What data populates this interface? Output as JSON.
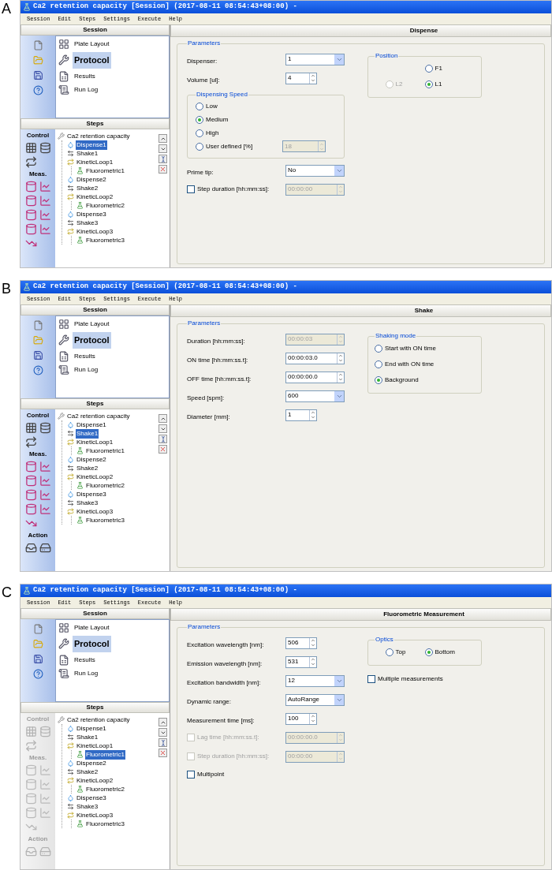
{
  "panels": [
    {
      "letter": "A",
      "window_title": "Ca2 retention capacity [Session] (2017-08-11 08:54:43+08:00) -",
      "menu": [
        "Session",
        "Edit",
        "Steps",
        "Settings",
        "Execute",
        "Help"
      ],
      "session": {
        "header": "Session",
        "items": [
          {
            "label": "Plate Layout",
            "kind": "plate",
            "selected": false
          },
          {
            "label": "Protocol",
            "kind": "protocol",
            "selected": true
          },
          {
            "label": "Results",
            "kind": "results",
            "selected": false
          },
          {
            "label": "Run Log",
            "kind": "log",
            "selected": false
          }
        ]
      },
      "steps": {
        "header": "Steps",
        "toolbox": {
          "disabled": false,
          "sections": [
            "Control",
            "Meas."
          ]
        },
        "tree": {
          "label": "Ca2 retention capacity",
          "kind": "root",
          "selected": false,
          "children": [
            {
              "label": "Dispense1",
              "kind": "dispense",
              "selected": true
            },
            {
              "label": "Shake1",
              "kind": "shake",
              "selected": false
            },
            {
              "label": "KineticLoop1",
              "kind": "loop",
              "selected": false,
              "children": [
                {
                  "label": "Fluorometric1",
                  "kind": "fluoro",
                  "selected": false
                }
              ]
            },
            {
              "label": "Dispense2",
              "kind": "dispense",
              "selected": false
            },
            {
              "label": "Shake2",
              "kind": "shake",
              "selected": false
            },
            {
              "label": "KineticLoop2",
              "kind": "loop",
              "selected": false,
              "children": [
                {
                  "label": "Fluorometric2",
                  "kind": "fluoro",
                  "selected": false
                }
              ]
            },
            {
              "label": "Dispense3",
              "kind": "dispense",
              "selected": false
            },
            {
              "label": "Shake3",
              "kind": "shake",
              "selected": false
            },
            {
              "label": "KineticLoop3",
              "kind": "loop",
              "selected": false,
              "children": [
                {
                  "label": "Fluorometric3",
                  "kind": "fluoro",
                  "selected": false
                }
              ]
            }
          ]
        }
      },
      "editor": {
        "title": "Dispense",
        "group": "Parameters",
        "fields": [
          {
            "kind": "select",
            "label": "Dispenser:",
            "value": "1",
            "disabled": false
          },
          {
            "kind": "spin",
            "label": "Volume [ul]:",
            "value": "4",
            "disabled": false
          },
          {
            "kind": "radio-group",
            "label": "Dispensing Speed",
            "options": [
              {
                "label": "Low",
                "selected": false
              },
              {
                "label": "Medium",
                "selected": true
              },
              {
                "label": "High",
                "selected": false
              },
              {
                "label": "User defined [%]",
                "selected": false,
                "value": "18",
                "value_disabled": true
              }
            ]
          },
          {
            "kind": "select",
            "label": "Prime tip:",
            "value": "No",
            "disabled": false
          },
          {
            "kind": "checkbox-spin",
            "label": "Step duration [hh:mm:ss]:",
            "checked": false,
            "disabled": false,
            "value": "00:00:00",
            "value_disabled": true
          }
        ],
        "side": [
          {
            "kind": "radio-group",
            "label": "Position",
            "rows": [
              [
                "",
                {
                  "label": "F1",
                  "selected": false,
                  "disabled": false
                }
              ],
              [
                {
                  "label": "L2",
                  "selected": false,
                  "disabled": true
                },
                {
                  "label": "L1",
                  "selected": true,
                  "disabled": false
                }
              ]
            ]
          }
        ]
      }
    },
    {
      "letter": "B",
      "window_title": "Ca2 retention capacity [Session] (2017-08-11 08:54:43+08:00) -",
      "menu": [
        "Session",
        "Edit",
        "Steps",
        "Settings",
        "Execute",
        "Help"
      ],
      "session": {
        "header": "Session",
        "items": [
          {
            "label": "Plate Layout",
            "kind": "plate",
            "selected": false
          },
          {
            "label": "Protocol",
            "kind": "protocol",
            "selected": true
          },
          {
            "label": "Results",
            "kind": "results",
            "selected": false
          },
          {
            "label": "Run Log",
            "kind": "log",
            "selected": false
          }
        ]
      },
      "steps": {
        "header": "Steps",
        "toolbox": {
          "disabled": false,
          "sections": [
            "Control",
            "Meas.",
            "Action"
          ]
        },
        "tree": {
          "label": "Ca2 retention capacity",
          "kind": "root",
          "selected": false,
          "children": [
            {
              "label": "Dispense1",
              "kind": "dispense",
              "selected": false
            },
            {
              "label": "Shake1",
              "kind": "shake",
              "selected": true
            },
            {
              "label": "KineticLoop1",
              "kind": "loop",
              "selected": false,
              "children": [
                {
                  "label": "Fluorometric1",
                  "kind": "fluoro",
                  "selected": false
                }
              ]
            },
            {
              "label": "Dispense2",
              "kind": "dispense",
              "selected": false
            },
            {
              "label": "Shake2",
              "kind": "shake",
              "selected": false
            },
            {
              "label": "KineticLoop2",
              "kind": "loop",
              "selected": false,
              "children": [
                {
                  "label": "Fluorometric2",
                  "kind": "fluoro",
                  "selected": false
                }
              ]
            },
            {
              "label": "Dispense3",
              "kind": "dispense",
              "selected": false
            },
            {
              "label": "Shake3",
              "kind": "shake",
              "selected": false
            },
            {
              "label": "KineticLoop3",
              "kind": "loop",
              "selected": false,
              "children": [
                {
                  "label": "Fluorometric3",
                  "kind": "fluoro",
                  "selected": false
                }
              ]
            }
          ]
        }
      },
      "editor": {
        "title": "Shake",
        "group": "Parameters",
        "fields": [
          {
            "kind": "spin",
            "label": "Duration [hh:mm:ss]:",
            "value": "00:00:03",
            "disabled": true
          },
          {
            "kind": "spin",
            "label": "ON time [hh:mm:ss.t]:",
            "value": "00:00:03.0",
            "disabled": false
          },
          {
            "kind": "spin",
            "label": "OFF time [hh:mm:ss.t]:",
            "value": "00:00:00.0",
            "disabled": false
          },
          {
            "kind": "select",
            "label": "Speed [spm]:",
            "value": "600",
            "disabled": false
          },
          {
            "kind": "spin",
            "label": "Diameter [mm]:",
            "value": "1",
            "disabled": false
          }
        ],
        "side": [
          {
            "kind": "radio-group",
            "label": "Shaking mode",
            "rows": [
              [
                {
                  "label": "Start with ON time",
                  "selected": false,
                  "disabled": false
                }
              ],
              [
                {
                  "label": "End with ON time",
                  "selected": false,
                  "disabled": false
                }
              ],
              [
                {
                  "label": "Background",
                  "selected": true,
                  "disabled": false
                }
              ]
            ]
          }
        ]
      }
    },
    {
      "letter": "C",
      "window_title": "Ca2 retention capacity [Session] (2017-08-11 08:54:43+08:00) -",
      "menu": [
        "Session",
        "Edit",
        "Steps",
        "Settings",
        "Execute",
        "Help"
      ],
      "session": {
        "header": "Session",
        "items": [
          {
            "label": "Plate Layout",
            "kind": "plate",
            "selected": false
          },
          {
            "label": "Protocol",
            "kind": "protocol",
            "selected": true
          },
          {
            "label": "Results",
            "kind": "results",
            "selected": false
          },
          {
            "label": "Run Log",
            "kind": "log",
            "selected": false
          }
        ]
      },
      "steps": {
        "header": "Steps",
        "toolbox": {
          "disabled": true,
          "sections": [
            "Control",
            "Meas.",
            "Action"
          ]
        },
        "tree": {
          "label": "Ca2 retention capacity",
          "kind": "root",
          "selected": false,
          "children": [
            {
              "label": "Dispense1",
              "kind": "dispense",
              "selected": false
            },
            {
              "label": "Shake1",
              "kind": "shake",
              "selected": false
            },
            {
              "label": "KineticLoop1",
              "kind": "loop",
              "selected": false,
              "children": [
                {
                  "label": "Fluorometric1",
                  "kind": "fluoro",
                  "selected": true
                }
              ]
            },
            {
              "label": "Dispense2",
              "kind": "dispense",
              "selected": false
            },
            {
              "label": "Shake2",
              "kind": "shake",
              "selected": false
            },
            {
              "label": "KineticLoop2",
              "kind": "loop",
              "selected": false,
              "children": [
                {
                  "label": "Fluorometric2",
                  "kind": "fluoro",
                  "selected": false
                }
              ]
            },
            {
              "label": "Dispense3",
              "kind": "dispense",
              "selected": false
            },
            {
              "label": "Shake3",
              "kind": "shake",
              "selected": false
            },
            {
              "label": "KineticLoop3",
              "kind": "loop",
              "selected": false,
              "children": [
                {
                  "label": "Fluorometric3",
                  "kind": "fluoro",
                  "selected": false
                }
              ]
            }
          ]
        }
      },
      "editor": {
        "title": "Fluorometric Measurement",
        "group": "Parameters",
        "fields": [
          {
            "kind": "spin",
            "label": "Excitation wavelength [nm]:",
            "value": "506",
            "disabled": false
          },
          {
            "kind": "spin",
            "label": "Emission wavelength [nm]:",
            "value": "531",
            "disabled": false
          },
          {
            "kind": "select",
            "label": "Excitation bandwidth [nm]:",
            "value": "12",
            "disabled": false
          },
          {
            "kind": "select",
            "label": "Dynamic range:",
            "value": "AutoRange",
            "disabled": false
          },
          {
            "kind": "spin",
            "label": "Measurement time [ms]:",
            "value": "100",
            "disabled": false
          },
          {
            "kind": "checkbox-spin",
            "label": "Lag time [hh:mm:ss.t]:",
            "checked": false,
            "disabled": true,
            "value": "00:00:00.0",
            "value_disabled": true
          },
          {
            "kind": "checkbox-spin",
            "label": "Step duration [hh:mm:ss]:",
            "checked": false,
            "disabled": true,
            "value": "00:00:00",
            "value_disabled": true
          },
          {
            "kind": "checkbox",
            "label": "Multipoint",
            "checked": false,
            "disabled": false
          }
        ],
        "side": [
          {
            "kind": "radio-group",
            "label": "Optics",
            "rows": [
              [
                {
                  "label": "Top",
                  "selected": false,
                  "disabled": false
                },
                {
                  "label": "Bottom",
                  "selected": true,
                  "disabled": false
                }
              ]
            ]
          },
          {
            "kind": "checkbox",
            "label": "Multiple measurements",
            "checked": false,
            "disabled": false
          }
        ]
      }
    }
  ]
}
